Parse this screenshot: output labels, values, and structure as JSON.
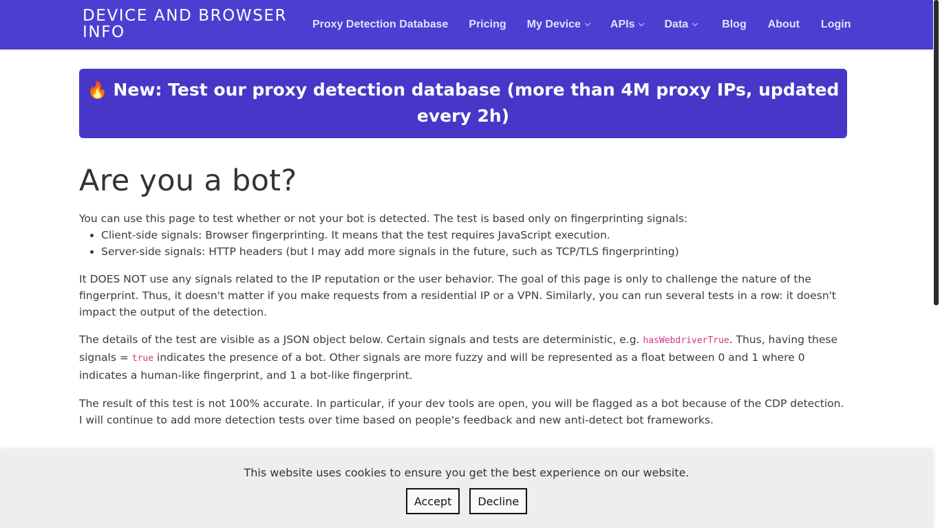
{
  "header": {
    "brand": "DEVICE AND BROWSER INFO",
    "nav": [
      {
        "label": "Proxy Detection Database",
        "dropdown": false
      },
      {
        "label": "Pricing",
        "dropdown": false
      },
      {
        "label": "My Device",
        "dropdown": true
      },
      {
        "label": "APIs",
        "dropdown": true
      },
      {
        "label": "Data",
        "dropdown": true
      },
      {
        "label": "Blog",
        "dropdown": false
      },
      {
        "label": "About",
        "dropdown": false
      },
      {
        "label": "Login",
        "dropdown": false
      }
    ]
  },
  "banner": {
    "icon": "fire-icon",
    "text": "New: Test our proxy detection database (more than 4M proxy IPs, updated every 2h)"
  },
  "main": {
    "title": "Are you a bot?",
    "intro": "You can use this page to test whether or not your bot is detected. The test is based only on fingerprinting signals:",
    "bullets": [
      "Client-side signals: Browser fingerprinting. It means that the test requires JavaScript execution.",
      "Server-side signals: HTTP headers (but I may add more signals in the future, such as TCP/TLS fingerprinting)"
    ],
    "para2": "It DOES NOT use any signals related to the IP reputation or the user behavior. The goal of this page is only to challenge the nature of the fingerprint. Thus, it doesn't matter if you make requests from a residential IP or a VPN. Similarly, you can run several tests in a row: it doesn't impact the output of the detection.",
    "para3_a": "The details of the test are visible as a JSON object below. Certain signals and tests are deterministic, e.g. ",
    "para3_code1": "hasWebdriverTrue",
    "para3_b": ". Thus, having these signals = ",
    "para3_code2": "true",
    "para3_c": " indicates the presence of a bot. Other signals are more fuzzy and will be represented as a float between 0 and 1 where 0 indicates a human-like fingerprint, and 1 a bot-like fingerprint.",
    "para4": "The result of this test is not 100% accurate. In particular, if your dev tools are open, you will be flagged as a bot because of the CDP detection. I will continue to add more detection tests over time based on people's feedback and new anti-detect bot frameworks."
  },
  "cookie": {
    "text": "This website uses cookies to ensure you get the best experience on our website.",
    "accept": "Accept",
    "decline": "Decline"
  },
  "colors": {
    "header_bg": "#4c3ed0",
    "banner_bg": "#4836c8",
    "code": "#d63384"
  }
}
